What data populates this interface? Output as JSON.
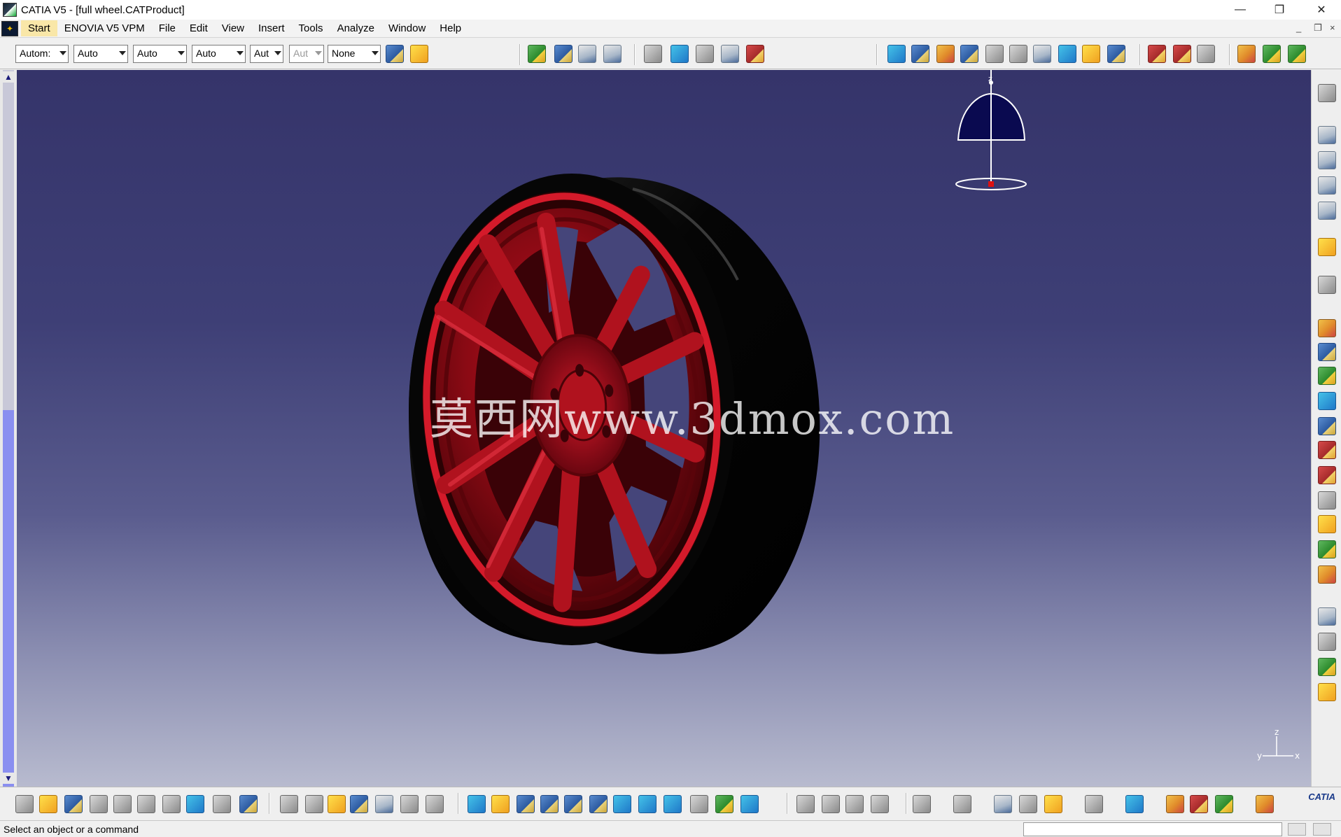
{
  "window": {
    "title": "CATIA V5 - [full wheel.CATProduct]",
    "controls": {
      "minimize": "—",
      "restore": "❐",
      "close": "✕"
    }
  },
  "menubar": {
    "start": "Start",
    "items": [
      "ENOVIA V5 VPM",
      "File",
      "Edit",
      "View",
      "Insert",
      "Tools",
      "Analyze",
      "Window",
      "Help"
    ],
    "doc_controls": {
      "minimize": "_",
      "restore": "❐",
      "close": "×"
    }
  },
  "graphic_properties": {
    "combos": [
      "Autom:",
      "Auto",
      "Auto",
      "Auto",
      "Aut",
      "Aut",
      "None"
    ]
  },
  "viewport": {
    "watermark": "莫西网www.3dmox.com",
    "compass_axis": "z",
    "axis_triad": {
      "z": "z",
      "x": "x",
      "y": "y"
    },
    "colors": {
      "rim": "#a0111a",
      "tire": "#050505",
      "background_top": "#35346a",
      "background_bottom": "#b8bbcf"
    }
  },
  "scrollbar": {
    "up": "▲",
    "down": "▼"
  },
  "status": {
    "message": "Select an object or a command",
    "command_input_value": ""
  },
  "branding": {
    "logo_text": "CATIA"
  }
}
